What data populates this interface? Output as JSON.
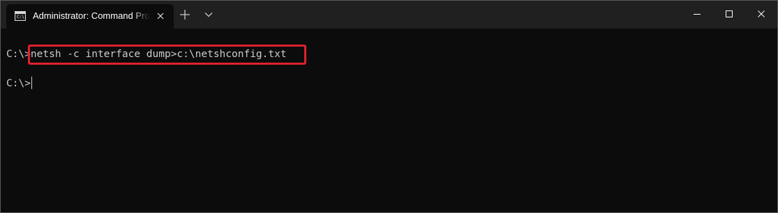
{
  "window": {
    "tab_title": "Administrator: Command Prompt",
    "tab_icon_text": "C:\\.",
    "icons": {
      "tab_icon": "command-prompt-icon",
      "tab_close": "close-icon",
      "new_tab": "plus-icon",
      "dropdown": "chevron-down-icon",
      "minimize": "minimize-icon",
      "maximize": "maximize-icon",
      "close": "close-icon"
    }
  },
  "terminal": {
    "prompt": "C:\\>",
    "command": "netsh -c interface dump>c:\\netshconfig.txt",
    "second_prompt": "C:\\>"
  },
  "colors": {
    "background": "#0c0c0c",
    "titlebar": "#202020",
    "text": "#cccccc",
    "highlight_border": "#e0212e"
  }
}
